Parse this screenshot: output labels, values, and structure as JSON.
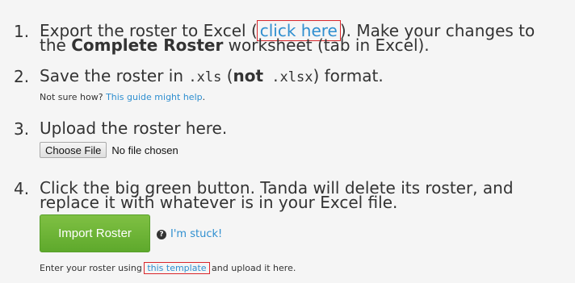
{
  "steps": [
    {
      "number": "1.",
      "line1_prefix": "Export the roster to Excel (",
      "line1_link": "click here",
      "line1_suffix": "). Make your changes to",
      "line2_prefix": "the ",
      "line2_bold": "Complete Roster",
      "line2_suffix": " worksheet (tab in Excel)."
    },
    {
      "number": "2.",
      "text_prefix": "Save the roster in ",
      "code1": ".xls",
      "text_mid": " (",
      "bold": "not",
      "code2": " .xlsx",
      "text_suffix": ") format.",
      "help_prefix": "Not sure how? ",
      "help_link": "This guide might help",
      "help_suffix": "."
    },
    {
      "number": "3.",
      "text": "Upload the roster here.",
      "file_button": "Choose File",
      "file_status": "No file chosen"
    },
    {
      "number": "4.",
      "line1": "Click the big green button. Tanda will delete its roster, and",
      "line2": "replace it with whatever is in your Excel file.",
      "import_button": "Import Roster",
      "stuck_icon": "?",
      "stuck_link": "I'm stuck!"
    }
  ],
  "footer": {
    "prefix": "Enter your roster using ",
    "link": "this template",
    "suffix": " and upload it here."
  },
  "colors": {
    "link": "#2f8fd0",
    "highlight_outline": "#d9262b",
    "import_button": "#6cb337"
  }
}
